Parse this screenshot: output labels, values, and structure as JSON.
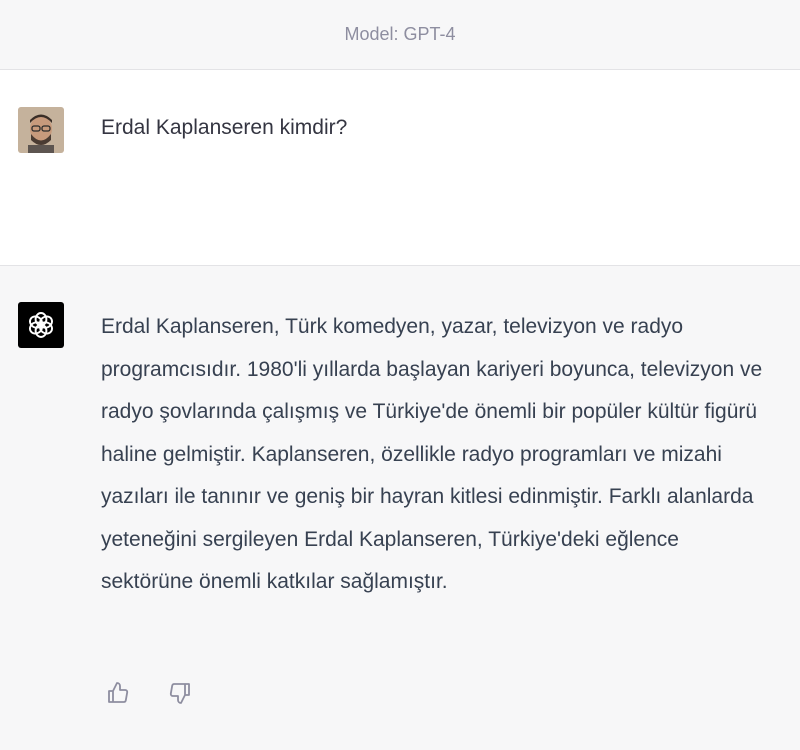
{
  "header": {
    "model_label": "Model: GPT-4"
  },
  "conversation": {
    "user_message": {
      "text": "Erdal Kaplanseren kimdir?",
      "avatar_icon": "user-photo-avatar"
    },
    "assistant_message": {
      "avatar_icon": "openai-logo-icon",
      "text": "Erdal Kaplanseren, Türk komedyen, yazar, televizyon ve radyo programcısıdır. 1980'li yıllarda başlayan kariyeri boyunca, televizyon ve radyo şovlarında çalışmış ve Türkiye'de önemli bir popüler kültür figürü haline gelmiştir. Kaplanseren, özellikle radyo programları ve mizahi yazıları ile tanınır ve geniş bir hayran kitlesi edinmiştir. Farklı alanlarda yeteneğini sergileyen Erdal Kaplanseren, Türkiye'deki eğlence sektörüne önemli katkılar sağlamıştır.",
      "actions": [
        {
          "icon": "thumbs-up-icon"
        },
        {
          "icon": "thumbs-down-icon"
        }
      ]
    }
  },
  "colors": {
    "header_bg": "#f7f7f8",
    "assistant_bg": "#f7f7f8",
    "text": "#374151",
    "muted": "#8e8ea0"
  }
}
